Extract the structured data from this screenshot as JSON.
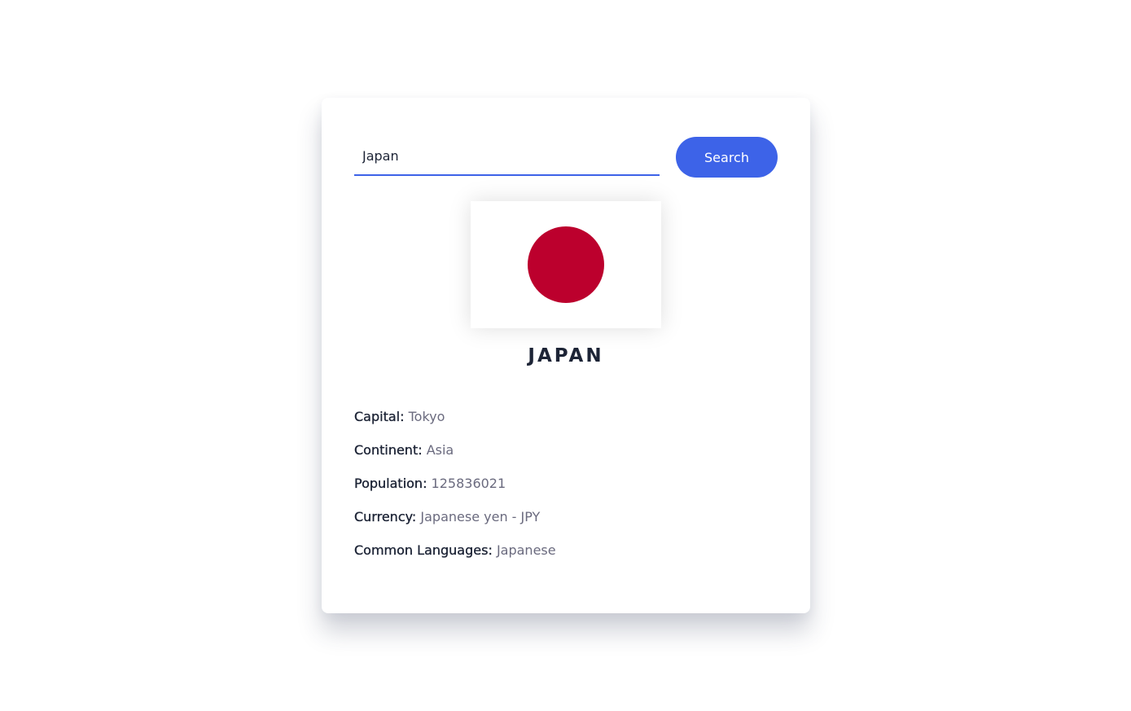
{
  "search": {
    "value": "Japan",
    "button_label": "Search"
  },
  "colors": {
    "accent": "#3d63e8",
    "flag_red": "#bc002d",
    "text_dark": "#1d2436",
    "text_muted": "#6a6a7e"
  },
  "country": {
    "name": "JAPAN",
    "flag_icon": "japan-flag",
    "details": [
      {
        "label": "Capital:",
        "value": "Tokyo"
      },
      {
        "label": "Continent:",
        "value": "Asia"
      },
      {
        "label": "Population:",
        "value": "125836021"
      },
      {
        "label": "Currency:",
        "value": "Japanese yen - JPY"
      },
      {
        "label": "Common Languages:",
        "value": "Japanese"
      }
    ]
  }
}
